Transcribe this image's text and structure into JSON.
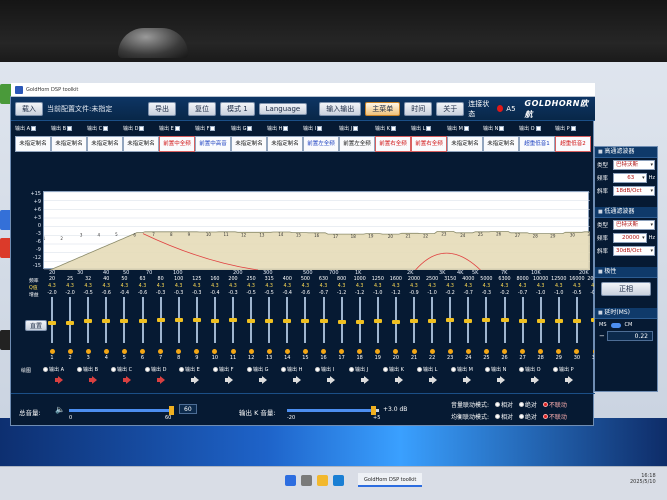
{
  "window_title": "GoldHorn DSP toolkit",
  "toolbar": {
    "load_label": "载入",
    "current_config_label": "当前配置文件:未指定",
    "export_label": "导出",
    "reset_label": "复位",
    "mode_label": "模式 1",
    "language_label": "Language",
    "input_output_label": "输入输出",
    "main_menu_label": "主菜单",
    "time_label": "时间",
    "about_label": "关于",
    "connect_status_label": "连接状态",
    "connect_value": "A5",
    "logo_text": "GOLDHORN欧航"
  },
  "channels": [
    {
      "tag": "输出 A",
      "name": "未指定制名",
      "style": ""
    },
    {
      "tag": "输出 B",
      "name": "未指定制名",
      "style": ""
    },
    {
      "tag": "输出 C",
      "name": "未指定制名",
      "style": ""
    },
    {
      "tag": "输出 D",
      "name": "未指定制名",
      "style": ""
    },
    {
      "tag": "输出 E",
      "name": "前置中全频",
      "style": "red"
    },
    {
      "tag": "输出 F",
      "name": "前置中高音",
      "style": "blue"
    },
    {
      "tag": "输出 G",
      "name": "未指定制名",
      "style": ""
    },
    {
      "tag": "输出 H",
      "name": "未指定制名",
      "style": ""
    },
    {
      "tag": "输出 I",
      "name": "前置左全频",
      "style": "blue"
    },
    {
      "tag": "输出 J",
      "name": "前置左全频",
      "style": ""
    },
    {
      "tag": "输出 K",
      "name": "前置右全频",
      "style": "red"
    },
    {
      "tag": "输出 L",
      "name": "前置右全频",
      "style": "red"
    },
    {
      "tag": "输出 M",
      "name": "未指定制名",
      "style": ""
    },
    {
      "tag": "输出 N",
      "name": "未指定制名",
      "style": ""
    },
    {
      "tag": "输出 O",
      "name": "超重低音1",
      "style": "blue"
    },
    {
      "tag": "输出 P",
      "name": "超重低音2",
      "style": "red"
    }
  ],
  "graph": {
    "y_ticks": [
      "+15",
      "+9",
      "+6",
      "+3",
      "0",
      "-3",
      "-6",
      "-9",
      "-12",
      "-15"
    ],
    "x_ticks": [
      "20",
      "30",
      "40",
      "50",
      "70",
      "100",
      "200",
      "300",
      "500",
      "700",
      "1K",
      "2K",
      "3K",
      "4K",
      "5K",
      "7K",
      "10K",
      "20K"
    ]
  },
  "params": {
    "freq_label": "频率",
    "q_label": "Q值",
    "gain_label": "增益",
    "freqs": [
      "20",
      "25",
      "32",
      "40",
      "50",
      "63",
      "80",
      "100",
      "125",
      "160",
      "200",
      "250",
      "315",
      "400",
      "500",
      "630",
      "800",
      "1000",
      "1250",
      "1600",
      "2000",
      "2500",
      "3150",
      "4000",
      "5000",
      "6300",
      "8000",
      "10000",
      "12500",
      "16000",
      "20000"
    ],
    "q": [
      "4.3",
      "4.3",
      "4.3",
      "4.3",
      "4.3",
      "4.3",
      "4.3",
      "4.3",
      "4.3",
      "4.3",
      "4.3",
      "4.3",
      "4.3",
      "4.3",
      "4.3",
      "4.3",
      "4.3",
      "4.3",
      "4.3",
      "4.3",
      "4.3",
      "4.3",
      "4.3",
      "4.3",
      "4.3",
      "4.3",
      "4.3",
      "4.3",
      "4.3",
      "4.3",
      "4.3"
    ],
    "gains": [
      "-2.0",
      "-2.0",
      "-0.5",
      "-0.6",
      "-0.4",
      "-0.6",
      "-0.3",
      "-0.3",
      "-0.3",
      "-0.4",
      "-0.3",
      "-0.5",
      "-0.5",
      "-0.4",
      "-0.6",
      "-0.7",
      "-1.2",
      "-1.2",
      "-1.0",
      "-1.2",
      "-0.9",
      "-1.0",
      "-0.2",
      "-0.7",
      "-0.3",
      "-0.2",
      "-0.7",
      "-1.0",
      "-1.0",
      "-0.5",
      "-0.3"
    ],
    "reset_eq_label": "直置"
  },
  "bands": [
    "1",
    "2",
    "3",
    "4",
    "5",
    "6",
    "7",
    "8",
    "9",
    "10",
    "11",
    "12",
    "13",
    "14",
    "15",
    "16",
    "17",
    "18",
    "19",
    "20",
    "21",
    "22",
    "23",
    "24",
    "25",
    "26",
    "27",
    "28",
    "29",
    "30",
    "31"
  ],
  "outputs": {
    "draw_label": "绘图",
    "items": [
      {
        "label": "输出 A",
        "mute": true
      },
      {
        "label": "输出 B",
        "mute": true
      },
      {
        "label": "输出 C",
        "mute": true
      },
      {
        "label": "输出 D",
        "mute": true
      },
      {
        "label": "输出 E",
        "mute": false
      },
      {
        "label": "输出 F",
        "mute": false
      },
      {
        "label": "输出 G",
        "mute": false
      },
      {
        "label": "输出 H",
        "mute": false
      },
      {
        "label": "输出 I",
        "mute": false
      },
      {
        "label": "输出 J",
        "mute": false
      },
      {
        "label": "输出 K",
        "mute": false
      },
      {
        "label": "输出 L",
        "mute": false
      },
      {
        "label": "输出 M",
        "mute": false
      },
      {
        "label": "输出 N",
        "mute": false
      },
      {
        "label": "输出 O",
        "mute": false
      },
      {
        "label": "输出 P",
        "mute": false
      }
    ]
  },
  "bottom": {
    "master_label": "总音量:",
    "master_min": "0",
    "master_max": "60",
    "master_value": "60",
    "out_k_label": "输出 K 音量:",
    "out_k_min": "-20",
    "out_k_max": "+5",
    "out_k_value": "+3.0 dB",
    "vol_link_label": "音量联动模式:",
    "eq_link_label": "均衡联动模式:",
    "opt_relative": "相对",
    "opt_absolute": "绝对",
    "opt_none": "不联动"
  },
  "highpass": {
    "title": "高通滤波器",
    "type_label": "类型",
    "type_value": "巴特沃斯",
    "freq_label": "频率",
    "freq_value": "63",
    "freq_unit": "Hz",
    "slope_label": "斜率",
    "slope_value": "18dB/Oct"
  },
  "lowpass": {
    "title": "低通滤波器",
    "type_label": "类型",
    "type_value": "巴特沃斯",
    "freq_label": "频率",
    "freq_value": "20000",
    "freq_unit": "Hz",
    "slope_label": "斜率",
    "slope_value": "30dB/Oct"
  },
  "polarity": {
    "title": "极性",
    "value": "正相"
  },
  "delay": {
    "title": "延时(MS)",
    "unit_ms": "MS",
    "unit_cm": "CM",
    "value": "0.22"
  },
  "taskbar": {
    "app_label": "GoldHorn DSP toolkit",
    "time": "16:18",
    "date": "2025/5/10"
  },
  "colors": {
    "accent": "#f0c020",
    "window_bg": "#061a33",
    "mute": "#d94040",
    "eq_curve": "#e6dcb8",
    "red_curve": "#e04040"
  }
}
